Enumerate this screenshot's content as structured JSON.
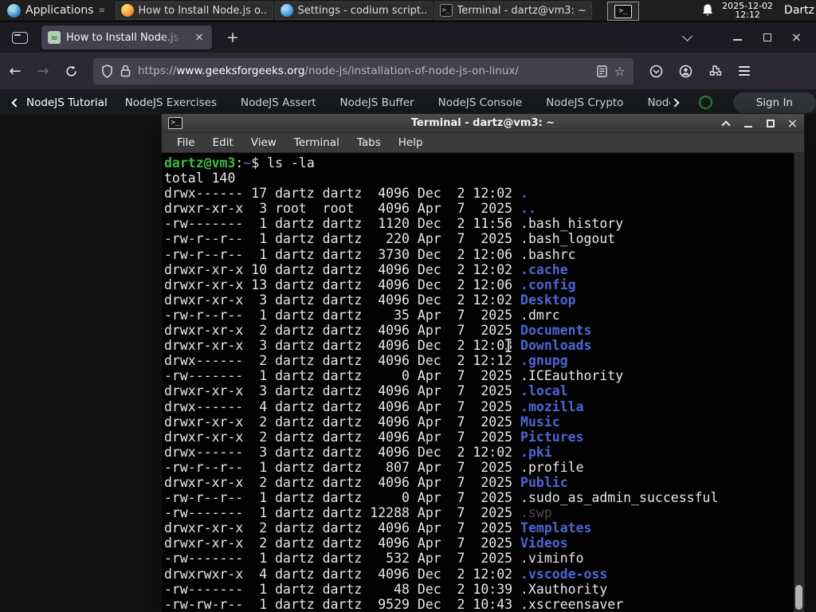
{
  "panel": {
    "applications_label": "Applications",
    "windows": [
      {
        "icon": "firefox",
        "label": "How to Install Node.js o..."
      },
      {
        "icon": "vscodium",
        "label": "Settings - codium script..."
      },
      {
        "icon": "terminal",
        "label": "Terminal - dartz@vm3: ~"
      }
    ],
    "clock": {
      "date": "2025-12-02",
      "time": "12:12"
    },
    "username": "Dartz"
  },
  "browser": {
    "tab_title": "How to Install Node.js on",
    "url": {
      "scheme": "https://",
      "domain": "www.geeksforgeeks.org",
      "path": "/node-js/installation-of-node-js-on-linux/"
    }
  },
  "site_nav": {
    "back_label": "NodeJS Tutorial",
    "items": [
      "NodeJS Exercises",
      "NodeJS Assert",
      "NodeJS Buffer",
      "NodeJS Console",
      "NodeJS Crypto",
      "NodeJS DNS",
      "Node"
    ],
    "sign_in_label": "Sign In"
  },
  "terminal": {
    "title": "Terminal - dartz@vm3: ~",
    "menu": [
      "File",
      "Edit",
      "View",
      "Terminal",
      "Tabs",
      "Help"
    ],
    "prompt": {
      "user_host": "dartz@vm3",
      "separator": ":",
      "cwd": "~",
      "symbol": "$",
      "command": "ls -la"
    },
    "total_line": "total 140",
    "listing": [
      {
        "perms": "drwx------",
        "links": "17",
        "owner": "dartz",
        "group": "dartz",
        "size": "4096",
        "month": "Dec",
        "day": "2",
        "time": "12:02",
        "name": ".",
        "type": "dir"
      },
      {
        "perms": "drwxr-xr-x",
        "links": "3",
        "owner": "root",
        "group": "root",
        "size": "4096",
        "month": "Apr",
        "day": "7",
        "time": "2025",
        "name": "..",
        "type": "dir"
      },
      {
        "perms": "-rw-------",
        "links": "1",
        "owner": "dartz",
        "group": "dartz",
        "size": "1120",
        "month": "Dec",
        "day": "2",
        "time": "11:56",
        "name": ".bash_history",
        "type": "file"
      },
      {
        "perms": "-rw-r--r--",
        "links": "1",
        "owner": "dartz",
        "group": "dartz",
        "size": "220",
        "month": "Apr",
        "day": "7",
        "time": "2025",
        "name": ".bash_logout",
        "type": "file"
      },
      {
        "perms": "-rw-r--r--",
        "links": "1",
        "owner": "dartz",
        "group": "dartz",
        "size": "3730",
        "month": "Dec",
        "day": "2",
        "time": "12:06",
        "name": ".bashrc",
        "type": "file"
      },
      {
        "perms": "drwxr-xr-x",
        "links": "10",
        "owner": "dartz",
        "group": "dartz",
        "size": "4096",
        "month": "Dec",
        "day": "2",
        "time": "12:02",
        "name": ".cache",
        "type": "dir"
      },
      {
        "perms": "drwxr-xr-x",
        "links": "13",
        "owner": "dartz",
        "group": "dartz",
        "size": "4096",
        "month": "Dec",
        "day": "2",
        "time": "12:06",
        "name": ".config",
        "type": "dir"
      },
      {
        "perms": "drwxr-xr-x",
        "links": "3",
        "owner": "dartz",
        "group": "dartz",
        "size": "4096",
        "month": "Dec",
        "day": "2",
        "time": "12:02",
        "name": "Desktop",
        "type": "dir"
      },
      {
        "perms": "-rw-r--r--",
        "links": "1",
        "owner": "dartz",
        "group": "dartz",
        "size": "35",
        "month": "Apr",
        "day": "7",
        "time": "2025",
        "name": ".dmrc",
        "type": "file"
      },
      {
        "perms": "drwxr-xr-x",
        "links": "2",
        "owner": "dartz",
        "group": "dartz",
        "size": "4096",
        "month": "Apr",
        "day": "7",
        "time": "2025",
        "name": "Documents",
        "type": "dir"
      },
      {
        "perms": "drwxr-xr-x",
        "links": "3",
        "owner": "dartz",
        "group": "dartz",
        "size": "4096",
        "month": "Dec",
        "day": "2",
        "time": "12:03",
        "name": "Downloads",
        "type": "dir"
      },
      {
        "perms": "drwx------",
        "links": "2",
        "owner": "dartz",
        "group": "dartz",
        "size": "4096",
        "month": "Dec",
        "day": "2",
        "time": "12:12",
        "name": ".gnupg",
        "type": "dir"
      },
      {
        "perms": "-rw-------",
        "links": "1",
        "owner": "dartz",
        "group": "dartz",
        "size": "0",
        "month": "Apr",
        "day": "7",
        "time": "2025",
        "name": ".ICEauthority",
        "type": "file"
      },
      {
        "perms": "drwxr-xr-x",
        "links": "3",
        "owner": "dartz",
        "group": "dartz",
        "size": "4096",
        "month": "Apr",
        "day": "7",
        "time": "2025",
        "name": ".local",
        "type": "dir"
      },
      {
        "perms": "drwx------",
        "links": "4",
        "owner": "dartz",
        "group": "dartz",
        "size": "4096",
        "month": "Apr",
        "day": "7",
        "time": "2025",
        "name": ".mozilla",
        "type": "dir"
      },
      {
        "perms": "drwxr-xr-x",
        "links": "2",
        "owner": "dartz",
        "group": "dartz",
        "size": "4096",
        "month": "Apr",
        "day": "7",
        "time": "2025",
        "name": "Music",
        "type": "dir"
      },
      {
        "perms": "drwxr-xr-x",
        "links": "2",
        "owner": "dartz",
        "group": "dartz",
        "size": "4096",
        "month": "Apr",
        "day": "7",
        "time": "2025",
        "name": "Pictures",
        "type": "dir"
      },
      {
        "perms": "drwx------",
        "links": "3",
        "owner": "dartz",
        "group": "dartz",
        "size": "4096",
        "month": "Dec",
        "day": "2",
        "time": "12:02",
        "name": ".pki",
        "type": "dir"
      },
      {
        "perms": "-rw-r--r--",
        "links": "1",
        "owner": "dartz",
        "group": "dartz",
        "size": "807",
        "month": "Apr",
        "day": "7",
        "time": "2025",
        "name": ".profile",
        "type": "file"
      },
      {
        "perms": "drwxr-xr-x",
        "links": "2",
        "owner": "dartz",
        "group": "dartz",
        "size": "4096",
        "month": "Apr",
        "day": "7",
        "time": "2025",
        "name": "Public",
        "type": "dir"
      },
      {
        "perms": "-rw-r--r--",
        "links": "1",
        "owner": "dartz",
        "group": "dartz",
        "size": "0",
        "month": "Apr",
        "day": "7",
        "time": "2025",
        "name": ".sudo_as_admin_successful",
        "type": "file"
      },
      {
        "perms": "-rw-------",
        "links": "1",
        "owner": "dartz",
        "group": "dartz",
        "size": "12288",
        "month": "Apr",
        "day": "7",
        "time": "2025",
        "name": ".swp",
        "type": "dim"
      },
      {
        "perms": "drwxr-xr-x",
        "links": "2",
        "owner": "dartz",
        "group": "dartz",
        "size": "4096",
        "month": "Apr",
        "day": "7",
        "time": "2025",
        "name": "Templates",
        "type": "dir"
      },
      {
        "perms": "drwxr-xr-x",
        "links": "2",
        "owner": "dartz",
        "group": "dartz",
        "size": "4096",
        "month": "Apr",
        "day": "7",
        "time": "2025",
        "name": "Videos",
        "type": "dir"
      },
      {
        "perms": "-rw-------",
        "links": "1",
        "owner": "dartz",
        "group": "dartz",
        "size": "532",
        "month": "Apr",
        "day": "7",
        "time": "2025",
        "name": ".viminfo",
        "type": "file"
      },
      {
        "perms": "drwxrwxr-x",
        "links": "4",
        "owner": "dartz",
        "group": "dartz",
        "size": "4096",
        "month": "Dec",
        "day": "2",
        "time": "12:02",
        "name": ".vscode-oss",
        "type": "dir"
      },
      {
        "perms": "-rw-------",
        "links": "1",
        "owner": "dartz",
        "group": "dartz",
        "size": "48",
        "month": "Dec",
        "day": "2",
        "time": "10:39",
        "name": ".Xauthority",
        "type": "file"
      },
      {
        "perms": "-rw-rw-r--",
        "links": "1",
        "owner": "dartz",
        "group": "dartz",
        "size": "9529",
        "month": "Dec",
        "day": "2",
        "time": "10:43",
        "name": ".xscreensaver",
        "type": "file"
      }
    ]
  },
  "icons": {
    "app_caret": "≡",
    "new_tab": "+",
    "close": "×",
    "back": "←",
    "forward": "→",
    "bookmark_star": "☆",
    "terminal_glyph": ">_",
    "favicon_glyph": "∞"
  },
  "colors": {
    "gfg_green": "#2f8d46",
    "terminal_green": "#3fbb3f",
    "terminal_blue": "#4e66d4",
    "terminal_dim": "#4b4b4b",
    "firefox_tab_bg": "#42414d"
  }
}
